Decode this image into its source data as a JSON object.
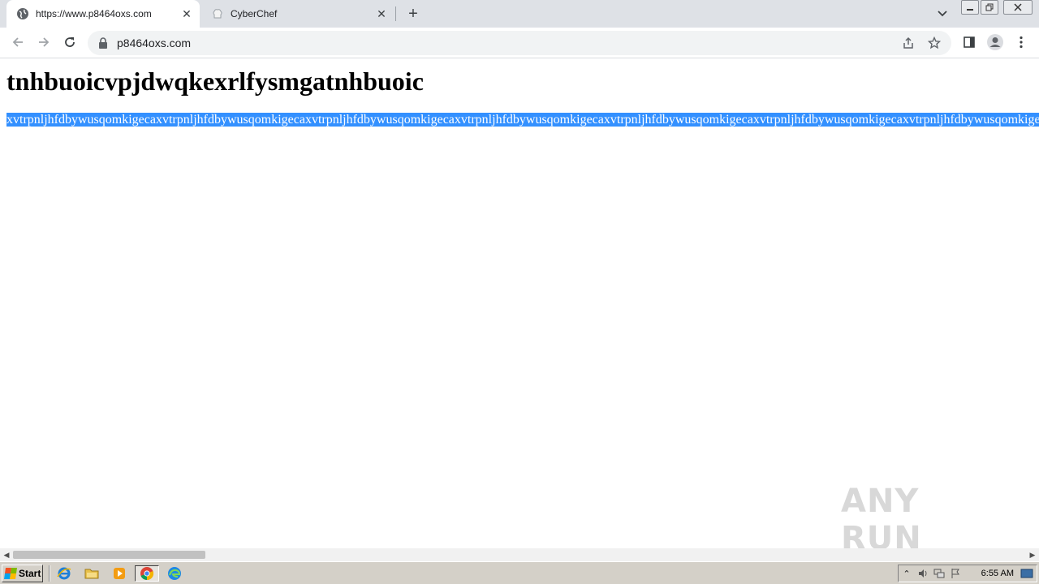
{
  "browser": {
    "tabs": [
      {
        "title": "https://www.p8464oxs.com",
        "active": true,
        "icon": "globe-icon"
      },
      {
        "title": "CyberChef",
        "active": false,
        "icon": "chef-hat-icon"
      }
    ],
    "new_tab_label": "+",
    "address": "p8464oxs.com"
  },
  "page": {
    "heading": "tnhbuoicvpjdwqkexrlfysmgatnhbuoic",
    "paragraph": "xvtrpnljhfdbywusqomkigecaxvtrpnljhfdbywusqomkigecaxvtrpnljhfdbywusqomkigecaxvtrpnljhfdbywusqomkigecaxvtrpnljhfdbywusqomkigecaxvtrpnljhfdbywusqomkigecaxvtrpnljhfdbywusqomkigecaxvtrpnljhfdbywusqomkigecaxvtrpnljhfdbyw",
    "selection_color": "#3390ff"
  },
  "watermark": "ANY RUN",
  "taskbar": {
    "start_label": "Start",
    "quick_launch": [
      "internet-explorer-icon",
      "folder-icon",
      "media-player-icon",
      "chrome-icon",
      "edge-icon"
    ],
    "clock": "6:55 AM"
  }
}
